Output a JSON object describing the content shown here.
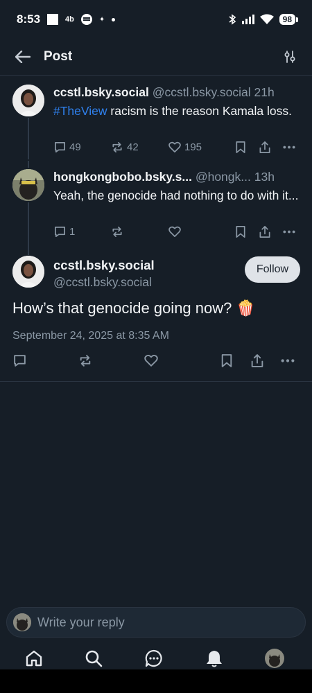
{
  "status_bar": {
    "time": "8:53",
    "notif_text": "4b",
    "battery": "98"
  },
  "header": {
    "title": "Post"
  },
  "parent_posts": [
    {
      "display_name": "ccstl.bsky.social",
      "handle": "@ccstl.bsky.social",
      "time_ago": "21h",
      "hashtag": "#TheView",
      "text": " racism is the reason Kamala loss.",
      "reply_count": "49",
      "repost_count": "42",
      "like_count": "195"
    },
    {
      "display_name": "hongkongbobo.bsky.s...",
      "handle": "@hongk...",
      "time_ago": "13h",
      "text": "Yeah, the genocide had nothing to do with it...",
      "reply_count": "1",
      "repost_count": "",
      "like_count": ""
    }
  ],
  "main_post": {
    "display_name": "ccstl.bsky.social",
    "handle": "@ccstl.bsky.social",
    "follow_label": "Follow",
    "text": "How’s that genocide going now? 🍿",
    "date": "September 24, 2025 at 8:35 AM"
  },
  "composer": {
    "placeholder": "Write your reply"
  },
  "bottom_nav": [
    "home-icon",
    "search-icon",
    "chat-icon",
    "bell-icon",
    "profile-avatar"
  ],
  "colors": {
    "background": "#161e27",
    "accent": "#2f80ed",
    "muted_text": "#8b98a5"
  }
}
